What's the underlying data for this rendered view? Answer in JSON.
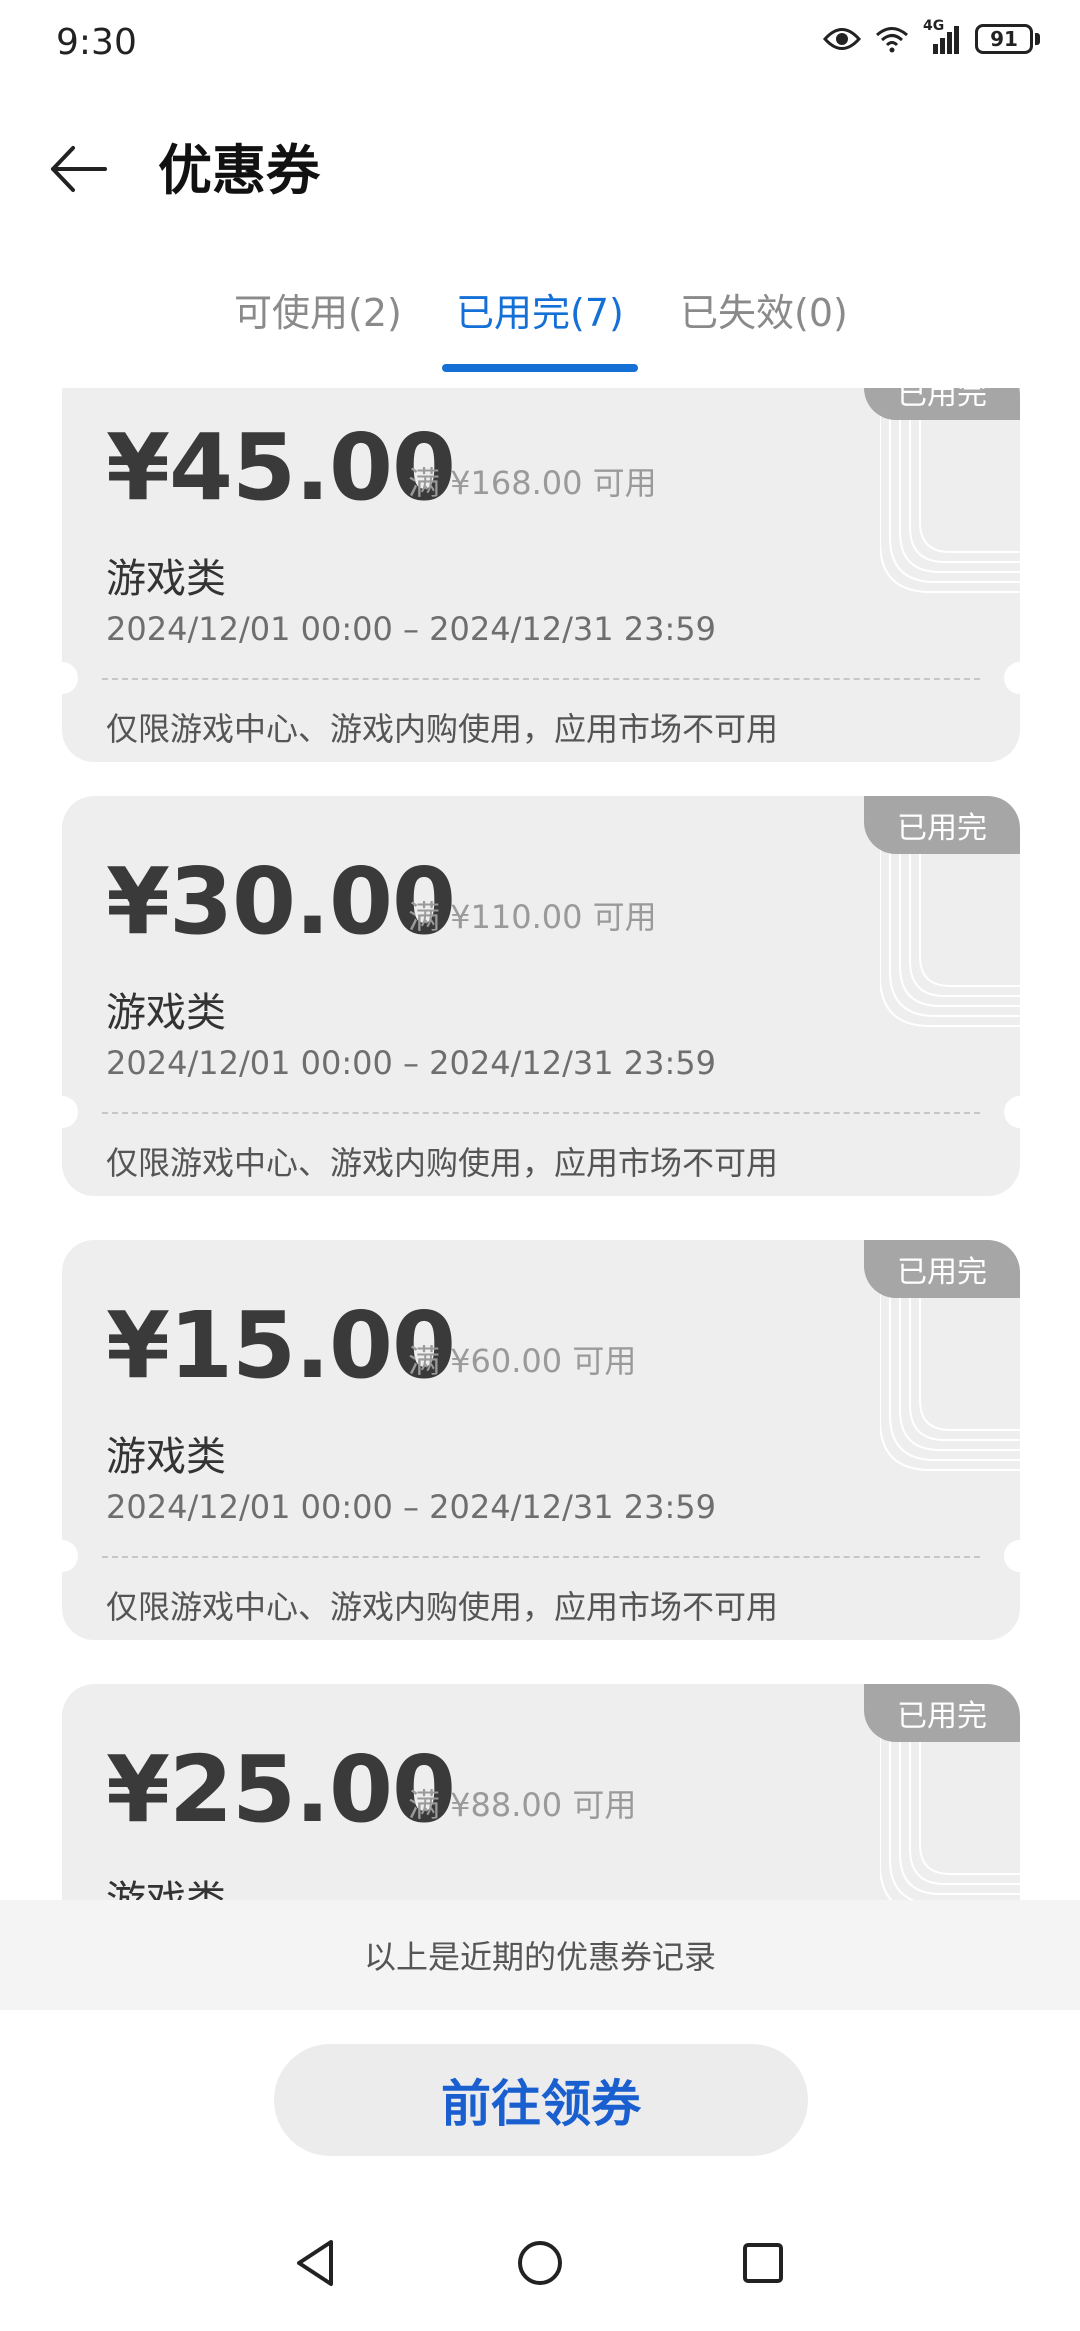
{
  "status_bar": {
    "time": "9:30",
    "network": "4G",
    "battery": "91",
    "icons": [
      "eye-icon",
      "wifi-icon",
      "signal-icon",
      "battery-icon"
    ]
  },
  "header": {
    "title": "优惠券",
    "back_icon": "arrow-left-icon"
  },
  "tabs": [
    {
      "label": "可使用(2)",
      "active": false
    },
    {
      "label": "已用完(7)",
      "active": true
    },
    {
      "label": "已失效(0)",
      "active": false
    }
  ],
  "coupons": [
    {
      "badge": "已用完",
      "amount": "¥45.00",
      "condition": "满 ¥168.00 可用",
      "category": "游戏类",
      "validity": "2024/12/01 00:00 – 2024/12/31 23:59",
      "restriction": "仅限游戏中心、游戏内购使用，应用市场不可用"
    },
    {
      "badge": "已用完",
      "amount": "¥30.00",
      "condition": "满 ¥110.00 可用",
      "category": "游戏类",
      "validity": "2024/12/01 00:00 – 2024/12/31 23:59",
      "restriction": "仅限游戏中心、游戏内购使用，应用市场不可用"
    },
    {
      "badge": "已用完",
      "amount": "¥15.00",
      "condition": "满 ¥60.00 可用",
      "category": "游戏类",
      "validity": "2024/12/01 00:00 – 2024/12/31 23:59",
      "restriction": "仅限游戏中心、游戏内购使用，应用市场不可用"
    },
    {
      "badge": "已用完",
      "amount": "¥25.00",
      "condition": "满 ¥88.00 可用",
      "category": "游戏类"
    }
  ],
  "footer_note": "以上是近期的优惠券记录",
  "cta_label": "前往领券",
  "nav_bar": {
    "icons": [
      "back-triangle-icon",
      "home-circle-icon",
      "recents-square-icon"
    ]
  },
  "colors": {
    "accent": "#1470d6",
    "cta_text": "#1a5fd0",
    "card_bg": "#eeeeee",
    "badge_bg": "#a6a6a6"
  }
}
